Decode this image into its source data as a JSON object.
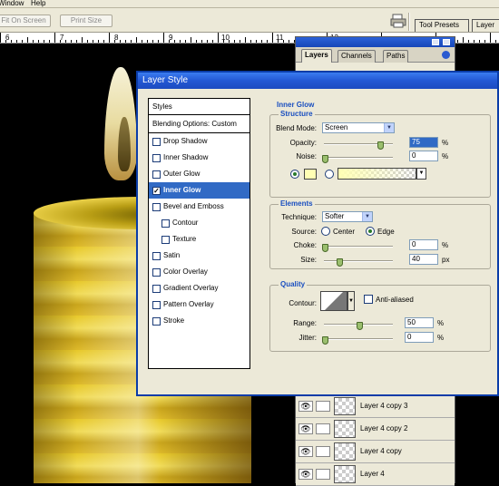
{
  "menu": {
    "window": "Window",
    "help": "Help"
  },
  "options_bar": {
    "fit_on_screen": "Fit On Screen",
    "print_size": "Print Size",
    "tool_presets": "Tool Presets",
    "layer_comps": "Layer"
  },
  "ruler": {
    "labels": [
      "6",
      "7",
      "8",
      "9",
      "10",
      "11",
      "12"
    ]
  },
  "layers_panel": {
    "tabs": [
      "Layers",
      "Channels",
      "Paths"
    ],
    "rows": [
      {
        "name": "Layer 4 copy 3"
      },
      {
        "name": "Layer 4 copy 2"
      },
      {
        "name": "Layer 4 copy"
      },
      {
        "name": "Layer 4"
      }
    ]
  },
  "dialog": {
    "title": "Layer Style",
    "styles_header": "Styles",
    "blending_options": "Blending Options: Custom",
    "items": [
      {
        "label": "Drop Shadow",
        "checked": false,
        "sub": false,
        "selected": false
      },
      {
        "label": "Inner Shadow",
        "checked": false,
        "sub": false,
        "selected": false
      },
      {
        "label": "Outer Glow",
        "checked": false,
        "sub": false,
        "selected": false
      },
      {
        "label": "Inner Glow",
        "checked": true,
        "sub": false,
        "selected": true
      },
      {
        "label": "Bevel and Emboss",
        "checked": false,
        "sub": false,
        "selected": false
      },
      {
        "label": "Contour",
        "checked": false,
        "sub": true,
        "selected": false
      },
      {
        "label": "Texture",
        "checked": false,
        "sub": true,
        "selected": false
      },
      {
        "label": "Satin",
        "checked": false,
        "sub": false,
        "selected": false
      },
      {
        "label": "Color Overlay",
        "checked": false,
        "sub": false,
        "selected": false
      },
      {
        "label": "Gradient Overlay",
        "checked": false,
        "sub": false,
        "selected": false
      },
      {
        "label": "Pattern Overlay",
        "checked": false,
        "sub": false,
        "selected": false
      },
      {
        "label": "Stroke",
        "checked": false,
        "sub": false,
        "selected": false
      }
    ],
    "inner_glow": {
      "title": "Inner Glow",
      "structure": {
        "label": "Structure",
        "blend_mode_label": "Blend Mode:",
        "blend_mode_value": "Screen",
        "opacity_label": "Opacity:",
        "opacity_value": "75",
        "opacity_unit": "%",
        "noise_label": "Noise:",
        "noise_value": "0",
        "noise_unit": "%",
        "glow_color": "#ffffb4"
      },
      "elements": {
        "label": "Elements",
        "technique_label": "Technique:",
        "technique_value": "Softer",
        "source_label": "Source:",
        "source_center": "Center",
        "source_edge": "Edge",
        "choke_label": "Choke:",
        "choke_value": "0",
        "choke_unit": "%",
        "size_label": "Size:",
        "size_value": "40",
        "size_unit": "px"
      },
      "quality": {
        "label": "Quality",
        "contour_label": "Contour:",
        "anti_aliased": "Anti-aliased",
        "range_label": "Range:",
        "range_value": "50",
        "range_unit": "%",
        "jitter_label": "Jitter:",
        "jitter_value": "0",
        "jitter_unit": "%"
      }
    }
  },
  "colors": {
    "titlebar": "#2358d4",
    "selection": "#316ac5",
    "section_title": "#1a4fc0",
    "panel_bg": "#ece9d8"
  }
}
